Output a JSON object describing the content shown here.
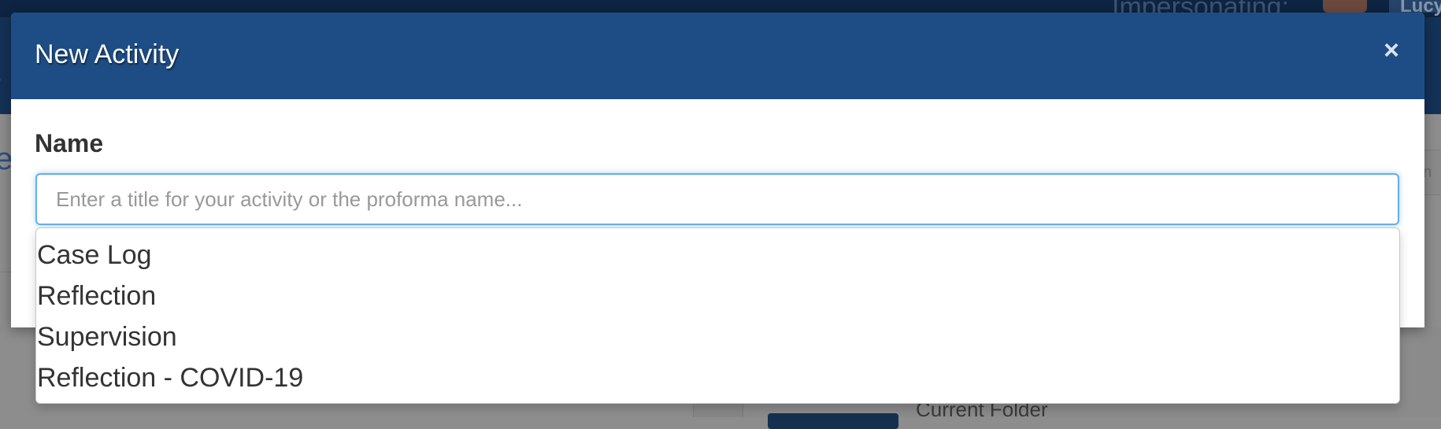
{
  "background": {
    "impersonating_label": "Impersonating:",
    "user_name": "Lucy",
    "search_placeholder_fragment": "r n",
    "folder_label": "Current Folder"
  },
  "modal": {
    "title": "New Activity",
    "close_label": "×",
    "name_label": "Name",
    "name_input": {
      "value": "",
      "placeholder": "Enter a title for your activity or the proforma name..."
    },
    "suggestions": [
      {
        "label": "Case Log"
      },
      {
        "label": "Reflection"
      },
      {
        "label": "Supervision"
      },
      {
        "label": "Reflection - COVID-19"
      }
    ]
  },
  "colors": {
    "header_bg": "#1e4d85",
    "focus_border": "#66afe9",
    "overlay": "#8d8d8d"
  }
}
